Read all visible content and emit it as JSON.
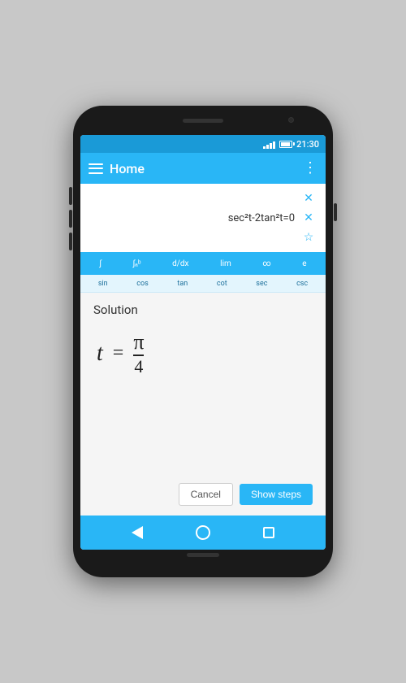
{
  "status_bar": {
    "time": "21:30"
  },
  "app_bar": {
    "title": "Home",
    "menu_label": "☰",
    "more_label": "⋮"
  },
  "input": {
    "expression": "sec²t-2tan²t=0",
    "placeholder": ""
  },
  "toolbar": {
    "items": [
      "∫",
      "∫ₐᵇ",
      "d/dx",
      "lim",
      "∞",
      "e"
    ]
  },
  "trig_row": {
    "items": [
      "sin",
      "cos",
      "tan",
      "cot",
      "sec",
      "csc"
    ]
  },
  "solution": {
    "title": "Solution",
    "variable": "t",
    "equals": "=",
    "numerator": "π",
    "denominator": "4"
  },
  "buttons": {
    "cancel": "Cancel",
    "show_steps": "Show steps"
  },
  "nav": {
    "back_label": "back",
    "home_label": "home",
    "square_label": "recents"
  },
  "colors": {
    "primary": "#29b6f6",
    "background": "#f5f5f5",
    "text": "#333333"
  }
}
